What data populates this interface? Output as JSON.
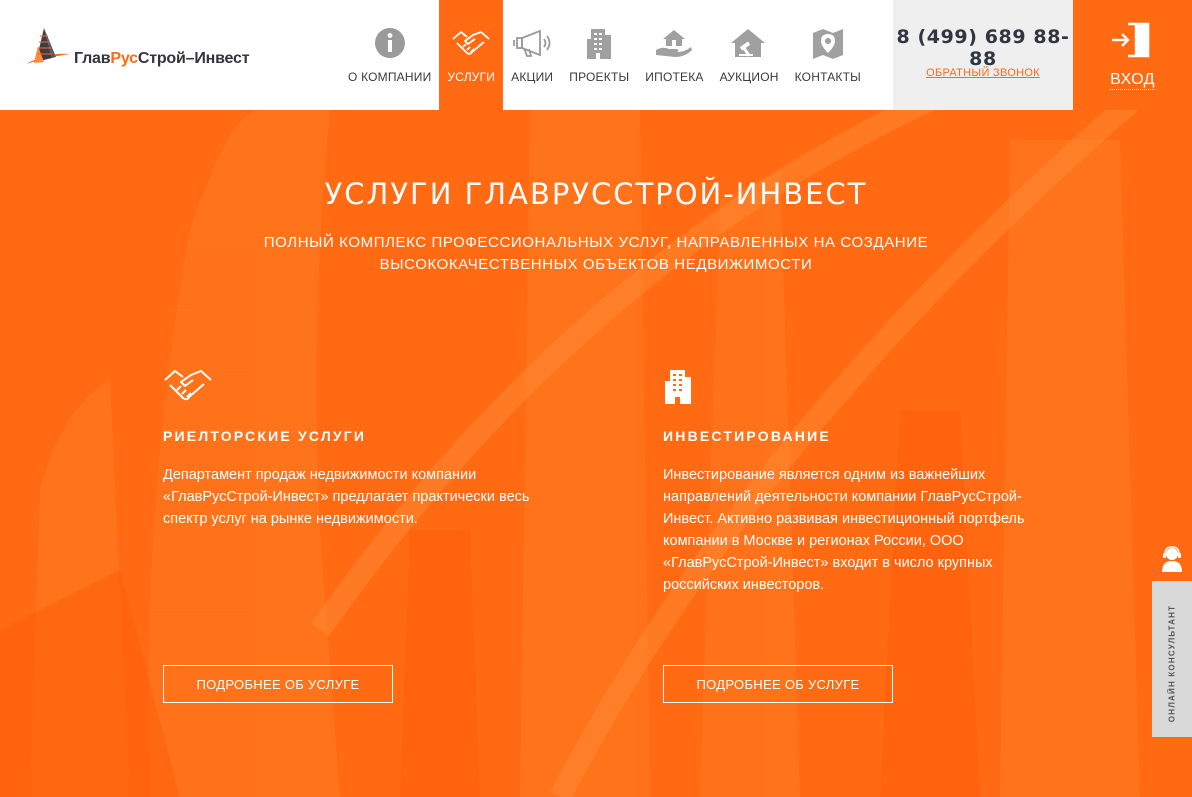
{
  "brand": {
    "logo_parts": [
      "Глав",
      "Рус",
      "Строй–Инвест"
    ],
    "accent_color": "#ff6a13"
  },
  "nav": {
    "items": [
      {
        "label": "О компании",
        "icon": "info-icon",
        "active": false
      },
      {
        "label": "Услуги",
        "icon": "handshake-icon",
        "active": true
      },
      {
        "label": "Акции",
        "icon": "megaphone-icon",
        "active": false
      },
      {
        "label": "Проекты",
        "icon": "building-icon",
        "active": false
      },
      {
        "label": "Ипотека",
        "icon": "hand-house-icon",
        "active": false
      },
      {
        "label": "Аукцион",
        "icon": "house-gavel-icon",
        "active": false
      },
      {
        "label": "Контакты",
        "icon": "map-pin-icon",
        "active": false
      }
    ]
  },
  "contact": {
    "phone": "8 (499) 689 88-88",
    "callback_label": "Обратный звонок"
  },
  "login": {
    "label": "ВХОД",
    "icon": "door-exit-icon"
  },
  "hero": {
    "title": "УСЛУГИ ГЛАВРУССТРОЙ-ИНВЕСТ",
    "subtitle": "Полный комплекс профессиональных услуг, направленных на создание высококачественных объектов недвижимости"
  },
  "services": [
    {
      "icon": "handshake-icon",
      "title": "Риелторские услуги",
      "text": "Департамент продаж недвижимости компании «ГлавРусСтрой-Инвест» предлагает практически весь спектр услуг на рынке недвижимости.",
      "button_label": "ПОДРОБНЕЕ ОБ УСЛУГЕ"
    },
    {
      "icon": "building-icon",
      "title": "Инвестирование",
      "text": "Инвестирование является одним из важнейших направлений деятельности компании ГлавРусСтрой-Инвест. Активно развивая инвестиционный портфель компании в Москве и регионах России, ООО «ГлавРусСтрой-Инвест» входит в число крупных российских инвесторов.",
      "button_label": "ПОДРОБНЕЕ ОБ УСЛУГЕ"
    }
  ],
  "consultant": {
    "label": "Онлайн консультант",
    "icon": "consultant-icon"
  }
}
